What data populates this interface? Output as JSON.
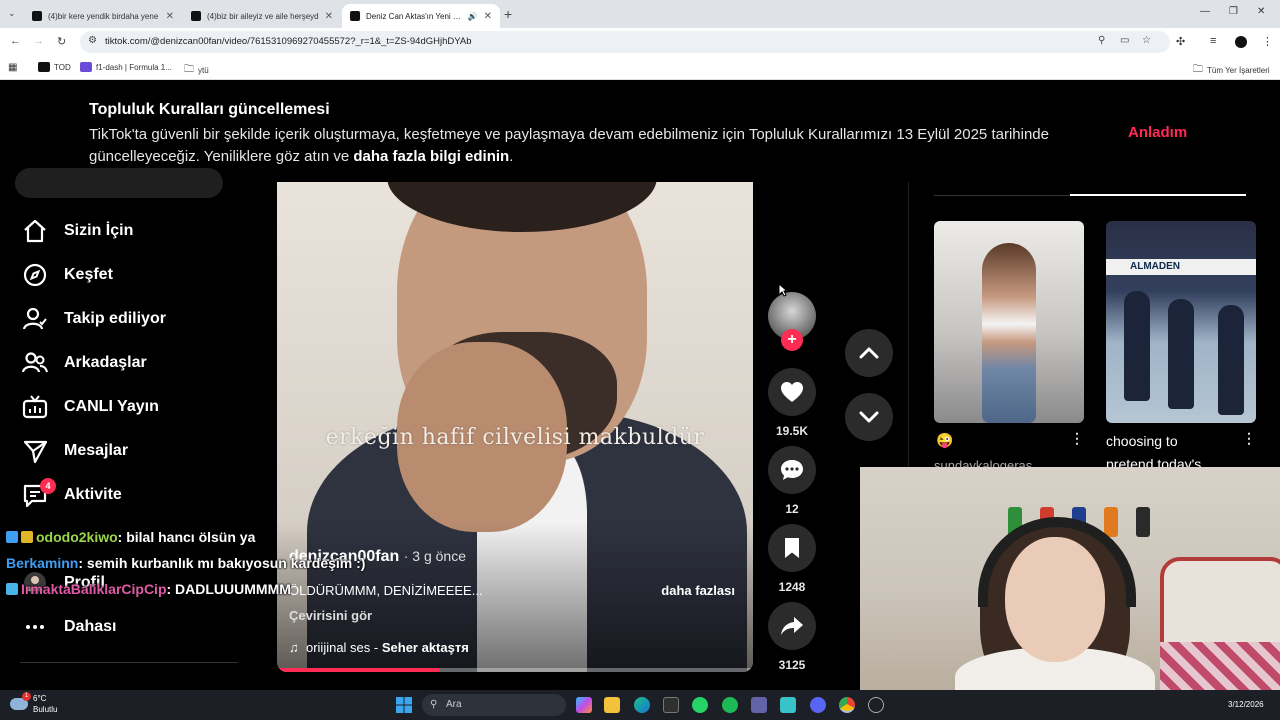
{
  "browser": {
    "tabs": [
      {
        "title": "(4)bir kere yendik birdaha yene",
        "active": false
      },
      {
        "title": "(4)biz bir aileyiz ve aile herşeyd",
        "active": false
      },
      {
        "title": "Deniz Can Aktas'ın Yeni Şarı",
        "active": true
      }
    ],
    "url": "tiktok.com/@denizcan00fan/video/7615310969270455572?_r=1&_t=ZS-94dGHjhDYAb",
    "bookmarks": [
      "TOD",
      "f1-dash | Formula 1...",
      "ytü"
    ],
    "all_bookmarks": "Tüm Yer İşaretleri"
  },
  "banner": {
    "title": "Topluluk Kuralları güncellemesi",
    "text": "TikTok'ta güvenli bir şekilde içerik oluşturmaya, keşfetmeye ve paylaşmaya devam edebilmeniz için Topluluk Kurallarımızı 13 Eylül 2025 tarihinde güncelleyeceğiz. Yeniliklere göz atın ve",
    "link": "daha fazla bilgi edinin",
    "end": ".",
    "button": "Anladım"
  },
  "sidebar": {
    "items": [
      {
        "label": "Sizin İçin",
        "icon": "home-icon"
      },
      {
        "label": "Keşfet",
        "icon": "compass-icon"
      },
      {
        "label": "Takip ediliyor",
        "icon": "following-icon"
      },
      {
        "label": "Arkadaşlar",
        "icon": "friends-icon"
      },
      {
        "label": "CANLI Yayın",
        "icon": "live-icon"
      },
      {
        "label": "Mesajlar",
        "icon": "send-icon"
      },
      {
        "label": "Aktivite",
        "icon": "activity-icon"
      },
      {
        "label": "Profil",
        "icon": "profile-icon"
      },
      {
        "label": "Dahası",
        "icon": "more-icon"
      }
    ],
    "activity_badge": "4"
  },
  "video": {
    "overlay_caption": "erkeğin hafif cilvelisi makbuldür",
    "author": "denizcan00fan",
    "time": "· 3 g önce",
    "description": "ÖLDÜRÜMMM, DENİZİMEEEE...",
    "more": "daha fazlası",
    "translate": "Çevirisini gör",
    "music_prefix": "oriijinal ses -",
    "music_artist": "Seher aktaşтя",
    "progress": 0.34
  },
  "actions": {
    "likes": "19.5K",
    "comments": "12",
    "saves": "1248",
    "shares": "3125",
    "follow": "+"
  },
  "recommendations": [
    {
      "caption": "😜",
      "author": "sundaykalogeras"
    },
    {
      "caption": "choosing to",
      "caption2": "pretend today's...",
      "sign": "ALMADEN"
    }
  ],
  "chat": [
    {
      "user": "ododo2kiwo",
      "message": ": bilal hancı ölsün ya"
    },
    {
      "user": "Berkaminn",
      "message": ": semih kurbanlık mı bakıyosun kardeşim :)"
    },
    {
      "user": "IrmaktaBaliklarCipCip",
      "message": ": DADLUUUMMMM"
    }
  ],
  "taskbar": {
    "weather_temp": "6°C",
    "weather_desc": "Bulutlu",
    "weather_badge": "1",
    "search": "Ara",
    "date": "3/12/2026"
  },
  "colors": {
    "accent": "#fe2c55",
    "background": "#000000"
  }
}
